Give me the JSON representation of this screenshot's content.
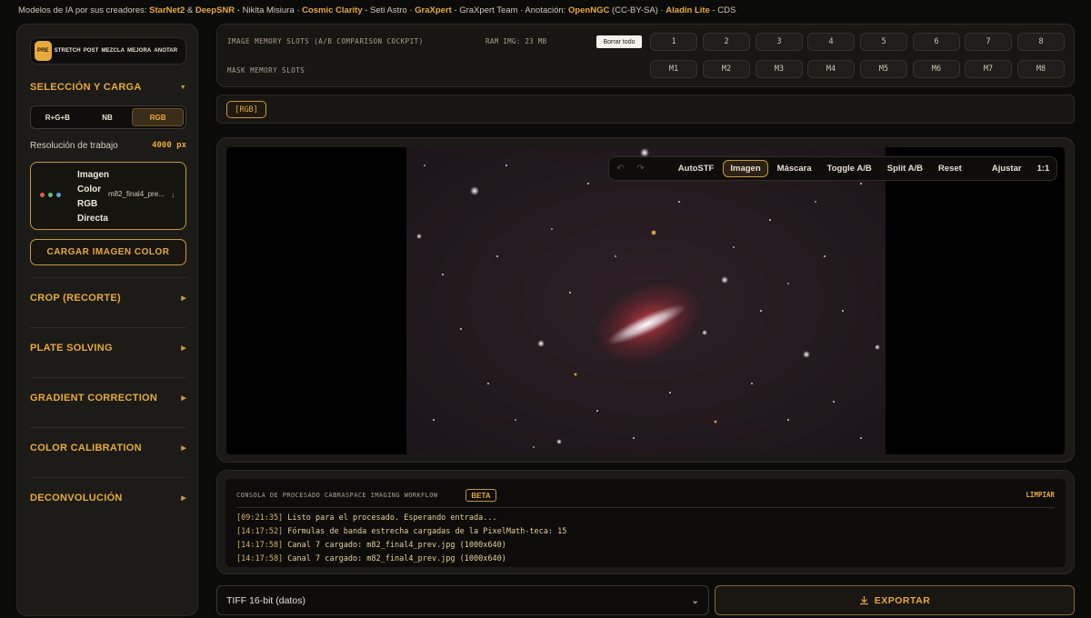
{
  "credits": {
    "prefix": "Modelos de IA por sus creadores: ",
    "parts": [
      {
        "t": "StarNet2",
        "hl": true
      },
      {
        "t": " & ",
        "hl": false
      },
      {
        "t": "DeepSNR",
        "hl": true
      },
      {
        "t": " - Nikita Misiura · ",
        "hl": false
      },
      {
        "t": "Cosmic Clarity",
        "hl": true
      },
      {
        "t": " - Seti Astro · ",
        "hl": false
      },
      {
        "t": "GraXpert",
        "hl": true
      },
      {
        "t": " - GraXpert Team · Anotación: ",
        "hl": false
      },
      {
        "t": "OpenNGC",
        "hl": true
      },
      {
        "t": " (CC-BY-SA) · ",
        "hl": false
      },
      {
        "t": "Aladin Lite",
        "hl": true
      },
      {
        "t": " - CDS",
        "hl": false
      }
    ]
  },
  "sidebar": {
    "mode_tabs": [
      "PRE",
      "STRETCH",
      "POST",
      "MEZCLA",
      "MEJORA",
      "ANOTAR"
    ],
    "active_mode": "PRE",
    "selection_title": "SELECCIÓN Y CARGA",
    "segments": [
      "R+G+B",
      "NB",
      "RGB"
    ],
    "active_segment": "RGB",
    "resolution_label": "Resolución de trabajo",
    "resolution_value": "4000 px",
    "file_label": "Imagen Color RGB Directa",
    "file_name": "m82_final4_pre...",
    "load_button": "CARGAR IMAGEN COLOR",
    "sections": [
      "CROP (RECORTE)",
      "PLATE SOLVING",
      "GRADIENT CORRECTION",
      "COLOR CALIBRATION",
      "DECONVOLUCIÓN"
    ],
    "colors": {
      "accent": "#e8a93c",
      "dot_red": "#e05a5a",
      "dot_green": "#5fc27a",
      "dot_blue": "#5aa0e0"
    }
  },
  "slots": {
    "title": "IMAGE MEMORY SLOTS (A/B COMPARISON COCKPIT)",
    "ram": "RAM IMG: 23 MB",
    "clear_all": "Borrar todo",
    "image_slots": [
      "1",
      "2",
      "3",
      "4",
      "5",
      "6",
      "7",
      "8"
    ],
    "mask_title": "MASK MEMORY SLOTS",
    "mask_slots": [
      "M1",
      "M2",
      "M3",
      "M4",
      "M5",
      "M6",
      "M7",
      "M8"
    ]
  },
  "channel": {
    "badge": "[RGB]"
  },
  "viewer": {
    "undo_icon": "undo-icon",
    "redo_icon": "redo-icon",
    "buttons": [
      "AutoSTF",
      "Imagen",
      "Máscara",
      "Toggle A/B",
      "Split A/B",
      "Reset"
    ],
    "active_button": "Imagen",
    "fit": "Ajustar",
    "one_to_one": "1:1"
  },
  "console": {
    "title": "CONSOLA DE PROCESADO CABRASPACE IMAGING WORKFLOW",
    "beta": "BETA",
    "clear": "LIMPIAR",
    "lines": [
      {
        "ts": "[09:21:35]",
        "msg": " Listo para el procesado. Esperando entrada..."
      },
      {
        "ts": "[14:17:52]",
        "msg": " Fórmulas de banda estrecha cargadas de la PixelMath-teca: 15"
      },
      {
        "ts": "[14:17:58]",
        "msg": " Canal 7 cargado: m82_final4_prev.jpg (1000x640)"
      },
      {
        "ts": "[14:17:58]",
        "msg": " Canal 7 cargado: m82_final4_prev.jpg (1000x640)"
      }
    ]
  },
  "export": {
    "format": "TIFF 16-bit (datos)",
    "button": "EXPORTAR",
    "icon": "download-icon"
  }
}
